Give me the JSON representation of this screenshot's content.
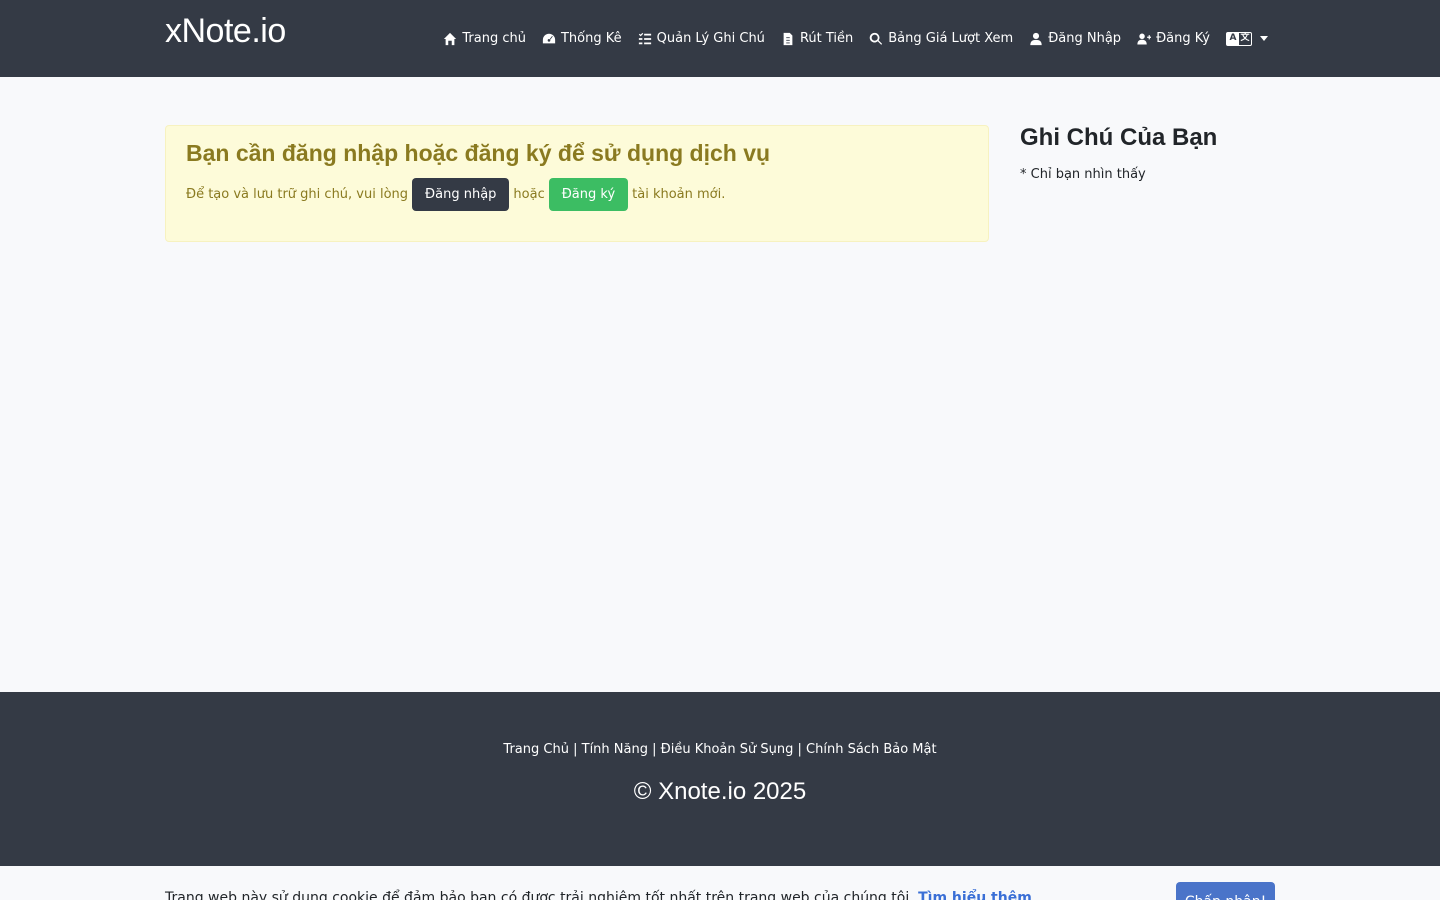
{
  "brand": "xNote.io",
  "nav": {
    "items": [
      {
        "label": "Trang chủ",
        "icon": "home-icon"
      },
      {
        "label": "Thống Kê",
        "icon": "gauge-icon"
      },
      {
        "label": "Quản Lý Ghi Chú",
        "icon": "list-check-icon"
      },
      {
        "label": "Rút Tiền",
        "icon": "file-invoice-icon"
      },
      {
        "label": "Bảng Giá Lượt Xem",
        "icon": "search-dollar-icon"
      },
      {
        "label": "Đăng Nhập",
        "icon": "user-icon"
      },
      {
        "label": "Đăng Ký",
        "icon": "user-plus-icon"
      }
    ],
    "language_icon": "language-icon"
  },
  "alert": {
    "title": "Bạn cần đăng nhập hoặc đăng ký để sử dụng dịch vụ",
    "text_before": "Để tạo và lưu trữ ghi chú, vui lòng",
    "login_button": "Đăng nhập",
    "text_middle": "hoặc",
    "register_button": "Đăng ký",
    "text_after": "tài khoản mới."
  },
  "sidebar": {
    "title": "Ghi Chú Của Bạn",
    "subtitle": "* Chỉ bạn nhìn thấy"
  },
  "footer": {
    "links": [
      "Trang Chủ",
      "Tính Năng",
      "Điều Khoản Sử Sụng",
      "Chính Sách Bảo Mật"
    ],
    "separator": "|",
    "copyright": "© Xnote.io 2025"
  },
  "cookie": {
    "text": "Trang web này sử dụng cookie để đảm bảo bạn có được trải nghiệm tốt nhất trên trang web của chúng tôi.",
    "link": "Tìm hiểu thêm",
    "accept_button": "Chấp nhận!"
  },
  "colors": {
    "navbar": "#343a45",
    "alert_bg": "#fdfbd9",
    "alert_text": "#8a7a20",
    "login_button": "#343a45",
    "register_button": "#3cbd63",
    "cookie_button": "#4a74c9"
  }
}
